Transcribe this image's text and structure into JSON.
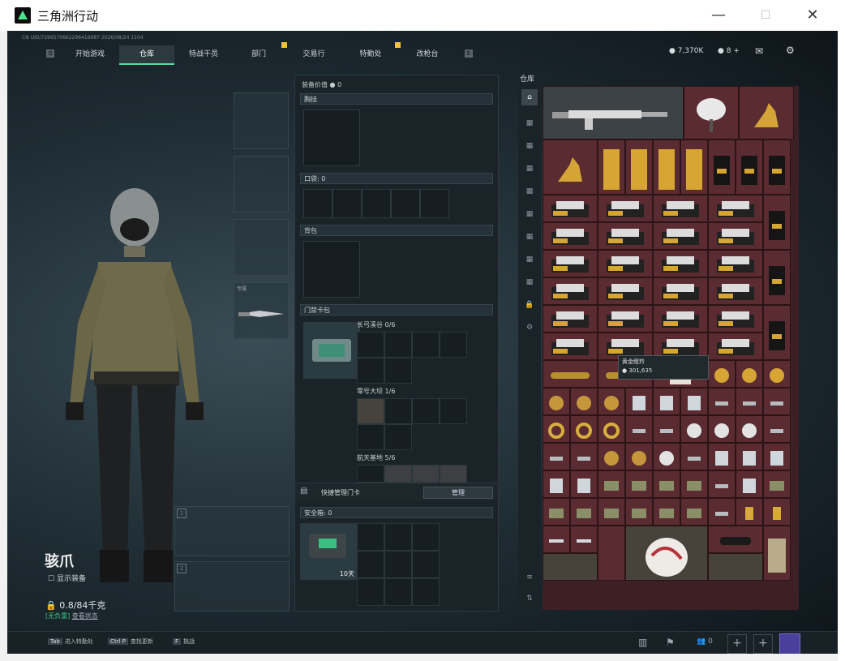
{
  "window": {
    "title": "三角洲行动",
    "minimize": "—",
    "maximize": "☐",
    "close": "✕"
  },
  "topinfo": "CN UID/7296570662296416687 2026/08/24 1104",
  "nav": {
    "keys": {
      "left": "Q",
      "right": "E"
    },
    "tabs": [
      "开始游戏",
      "仓库",
      "特战干员",
      "部门",
      "交易行",
      "特勤处",
      "改枪台"
    ],
    "active": 1
  },
  "currency": {
    "money": "7,370K",
    "tokens": "8"
  },
  "character": {
    "name": "骇爪",
    "show_equipment": "显示装备",
    "weight": "0.8/84千克",
    "status_green": "[无负重]",
    "status_more": "查看状态",
    "knife_label": "专属",
    "slot1": "1",
    "slot2": "2"
  },
  "midpanel": {
    "value_label": "装备价值",
    "value": "0",
    "chest": "胸挂",
    "pockets": "口袋",
    "pockets_count": "0",
    "backpack": "背包",
    "keycard": "门禁卡包",
    "keyzones": [
      {
        "name": "长弓溪谷",
        "count": "0/6"
      },
      {
        "name": "零号大坝",
        "count": "1/6"
      },
      {
        "name": "航天基地",
        "count": "5/6"
      }
    ],
    "quick_manage": "快捷管理门卡",
    "manage_btn": "管理",
    "safebox": "安全箱",
    "safebox_count": "0",
    "safebox_time": "10天"
  },
  "warehouse": {
    "label": "仓库",
    "tooltip_name": "黄金瞪羚",
    "tooltip_value": "301,635"
  },
  "bottom": {
    "k1": "Tab",
    "k1_text": "进入特勤处",
    "k2": "Ctrl P",
    "k2_text": "查找更新",
    "k3": "F",
    "k3_text": "挑战",
    "friends": "0"
  }
}
